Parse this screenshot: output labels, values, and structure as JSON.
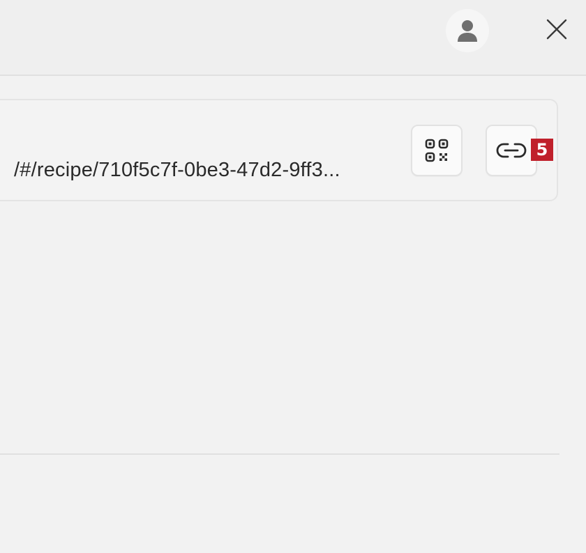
{
  "header": {
    "avatar_icon": "user-avatar-icon",
    "close_icon": "close-icon"
  },
  "share": {
    "url": "/#/recipe/710f5c7f-0be3-47d2-9ff3...",
    "qr_icon": "qr-code-icon",
    "copy_icon": "link-icon"
  },
  "badge": {
    "label": "5",
    "color": "#c0202b"
  }
}
